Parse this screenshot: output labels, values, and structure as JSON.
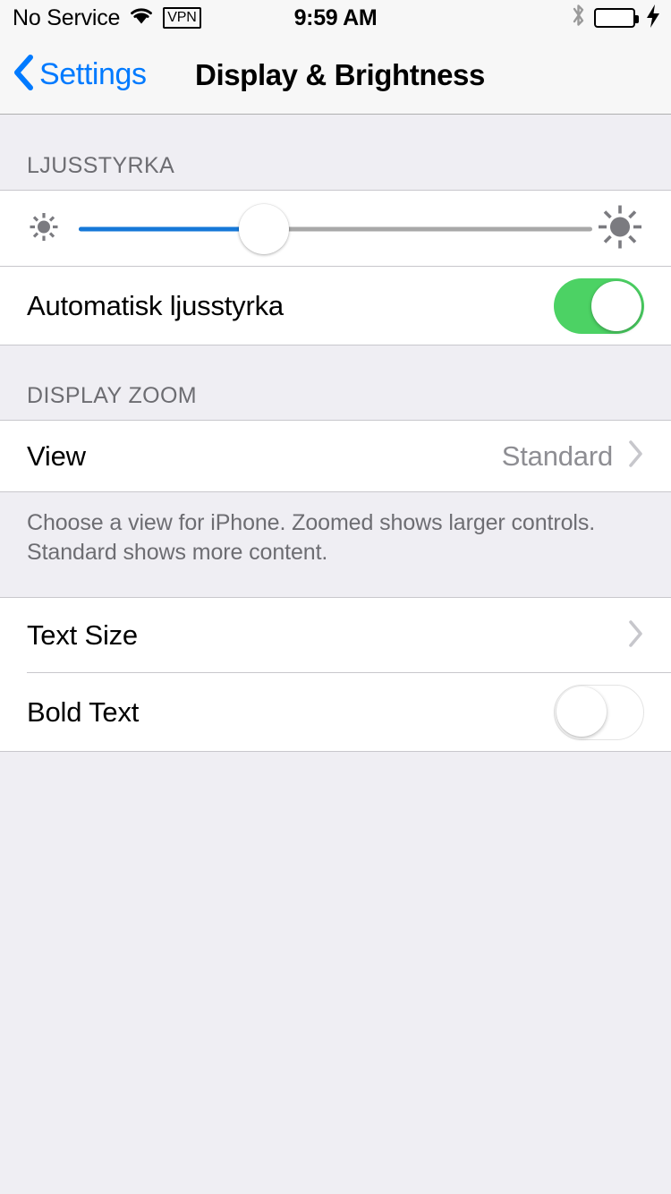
{
  "status_bar": {
    "carrier": "No Service",
    "wifi_icon": "wifi-icon",
    "vpn_badge": "VPN",
    "time": "9:59 AM",
    "bluetooth_icon": "bluetooth-icon",
    "battery_icon": "battery-full-icon",
    "charging_icon": "charging-bolt-icon"
  },
  "nav": {
    "back_icon": "chevron-left-icon",
    "back_label": "Settings",
    "title": "Display & Brightness"
  },
  "sections": {
    "brightness": {
      "header": "LJUSSTYRKA",
      "slider": {
        "name": "brightness-slider",
        "value_percent": 36,
        "min_icon": "sun-small-icon",
        "max_icon": "sun-large-icon",
        "fill_color": "#1678D8",
        "track_color": "#A8A8A8"
      },
      "auto_brightness": {
        "label": "Automatisk ljusstyrka",
        "toggle_state": "on",
        "toggle_color": "#4CD264"
      }
    },
    "display_zoom": {
      "header": "DISPLAY ZOOM",
      "view_row": {
        "label": "View",
        "value": "Standard",
        "chevron_icon": "chevron-right-icon"
      },
      "footer": "Choose a view for iPhone. Zoomed shows larger controls. Standard shows more content."
    },
    "text": {
      "text_size_row": {
        "label": "Text Size",
        "chevron_icon": "chevron-right-icon"
      },
      "bold_text_row": {
        "label": "Bold Text",
        "toggle_state": "off"
      }
    }
  }
}
